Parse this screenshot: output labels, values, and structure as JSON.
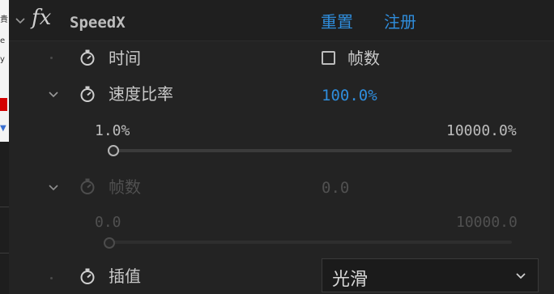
{
  "edge": {
    "line1": "貴",
    "line2": "e",
    "line3": "y"
  },
  "effect": {
    "fx_symbol": "fx",
    "name": "SpeedX",
    "reset_label": "重置",
    "register_label": "注册"
  },
  "properties": {
    "time": {
      "label": "时间",
      "frames_checkbox_label": "帧数",
      "checked": false
    },
    "speed_ratio": {
      "label": "速度比率",
      "value": "100.0%",
      "slider_min": "1.0%",
      "slider_max": "10000.0%",
      "slider_level": 0.0
    },
    "frames": {
      "label": "帧数",
      "value": "0.0",
      "slider_min": "0.0",
      "slider_max": "10000.0",
      "slider_level": 0.0,
      "disabled": true
    },
    "interpolation": {
      "label": "插值",
      "selected": "光滑"
    }
  },
  "colors": {
    "background": "#232323",
    "header": "#1f1f1f",
    "accent_blue": "#2f8ddc",
    "text": "#c9c9c9",
    "disabled_text": "#505050"
  },
  "icons": [
    "chevron-down-icon",
    "fx-icon",
    "stopwatch-icon",
    "checkbox-icon",
    "dropdown-arrow-icon"
  ]
}
